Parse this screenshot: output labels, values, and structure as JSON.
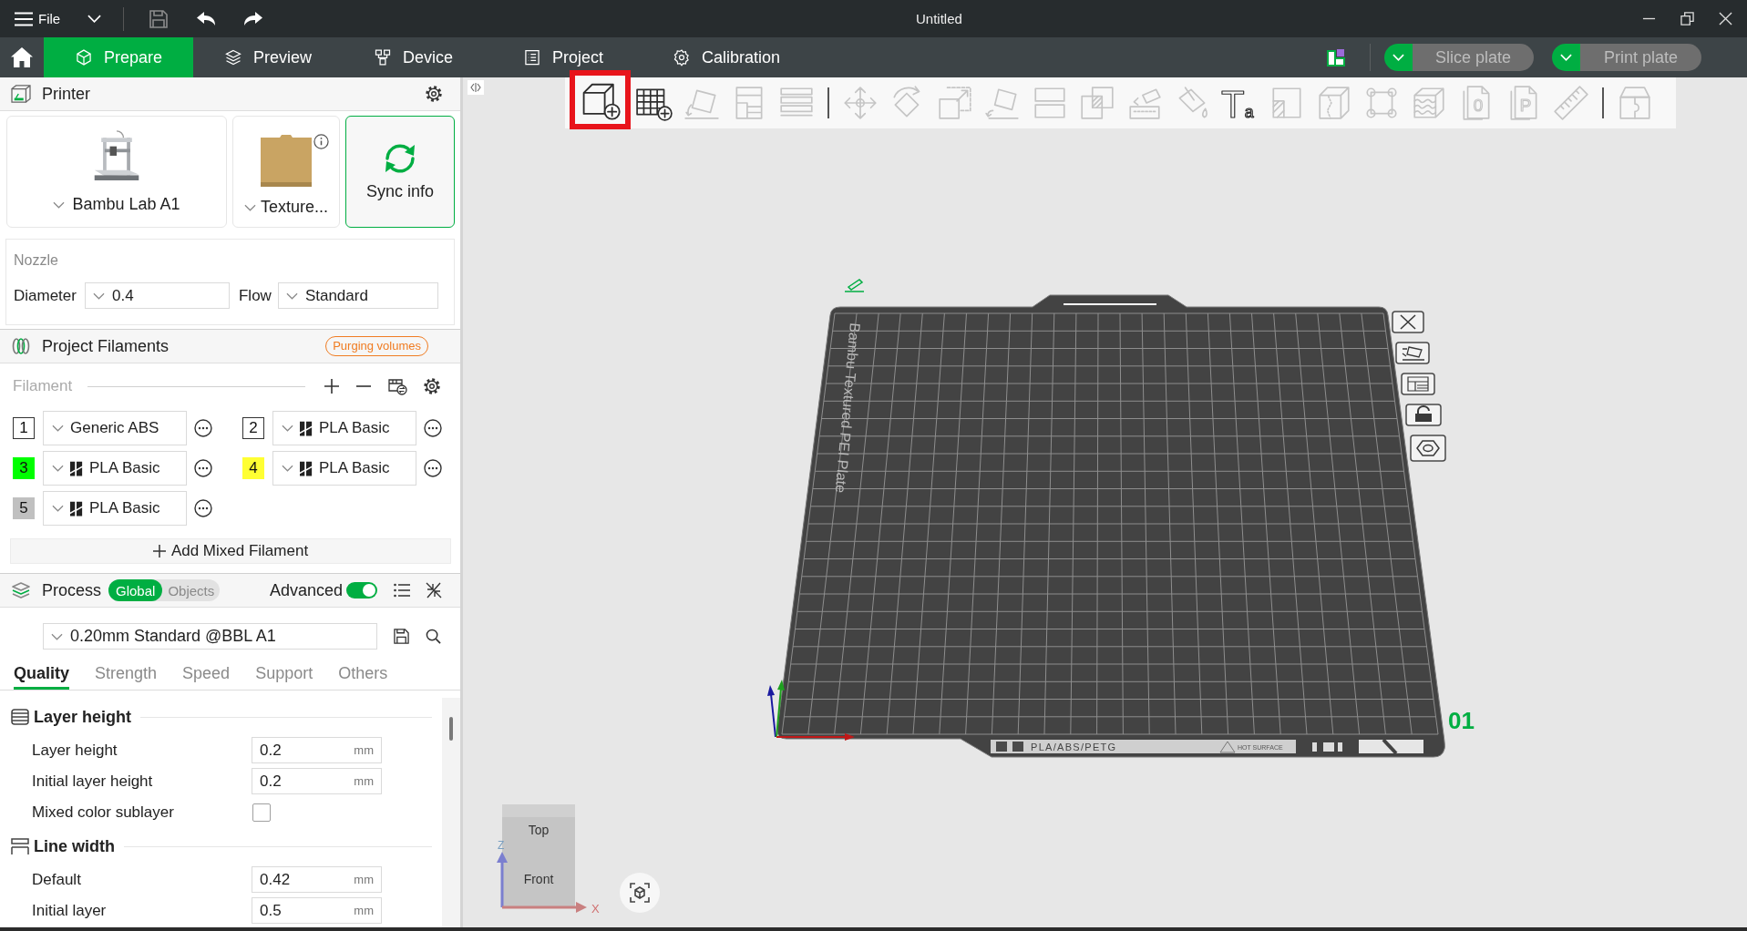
{
  "title_bar": {
    "menu": "File",
    "title": "Untitled"
  },
  "nav_tabs": [
    {
      "label": "Prepare",
      "kind": "prepare",
      "selected": true
    },
    {
      "label": "Preview",
      "kind": "preview",
      "selected": false
    },
    {
      "label": "Device",
      "kind": "device",
      "selected": false
    },
    {
      "label": "Project",
      "kind": "project",
      "selected": false
    },
    {
      "label": "Calibration",
      "kind": "calibration",
      "selected": false
    }
  ],
  "plate_actions": [
    {
      "label": "Slice plate",
      "disabled": true
    },
    {
      "label": "Print plate",
      "disabled": true
    }
  ],
  "printer": {
    "title": "Printer",
    "model": "Bambu Lab A1",
    "plate": "Texture...",
    "sync": "Sync info",
    "nozzle": {
      "title": "Nozzle",
      "diameter_label": "Diameter",
      "diameter": "0.4",
      "flow_label": "Flow",
      "flow": "Standard"
    }
  },
  "filaments": {
    "title": "Project Filaments",
    "purge": "Purging volumes",
    "label": "Filament",
    "items": [
      {
        "number": "1",
        "color": "#ffffff",
        "name": "Generic ABS",
        "brand_logo": false
      },
      {
        "number": "2",
        "color": "#ffffff",
        "name": "PLA Basic",
        "brand_logo": true
      },
      {
        "number": "3",
        "color": "#00ff00",
        "name": "PLA Basic",
        "brand_logo": true
      },
      {
        "number": "4",
        "color": "#ffff33",
        "name": "PLA Basic",
        "brand_logo": true
      },
      {
        "number": "5",
        "color": "#c0c0c0",
        "name": "PLA Basic",
        "brand_logo": true
      }
    ],
    "add_mixed": "Add Mixed Filament"
  },
  "process": {
    "title": "Process",
    "scopes": [
      {
        "label": "Global",
        "selected": true
      },
      {
        "label": "Objects",
        "selected": false
      }
    ],
    "advanced": {
      "label": "Advanced",
      "on": true
    },
    "preset": "0.20mm Standard @BBL A1",
    "tabs": [
      {
        "label": "Quality",
        "selected": true
      },
      {
        "label": "Strength",
        "selected": false
      },
      {
        "label": "Speed",
        "selected": false
      },
      {
        "label": "Support",
        "selected": false
      },
      {
        "label": "Others",
        "selected": false
      }
    ],
    "sections": [
      {
        "title": "Layer height",
        "kind": "layers",
        "rows": [
          {
            "kind": "number",
            "label": "Layer height",
            "value": "0.2",
            "unit": "mm"
          },
          {
            "kind": "number",
            "label": "Initial layer height",
            "value": "0.2",
            "unit": "mm"
          },
          {
            "kind": "checkbox",
            "label": "Mixed color sublayer",
            "checked": false
          }
        ]
      },
      {
        "title": "Line width",
        "kind": "width",
        "rows": [
          {
            "kind": "number",
            "label": "Default",
            "value": "0.42",
            "unit": "mm"
          },
          {
            "kind": "number",
            "label": "Initial layer",
            "value": "0.5",
            "unit": "mm"
          }
        ]
      }
    ]
  },
  "toolbar": {
    "groups": [
      [
        {
          "kind": "add",
          "disabled": false,
          "highlighted": true
        },
        {
          "kind": "addplate",
          "disabled": false,
          "highlighted": false
        },
        {
          "kind": "orient",
          "disabled": true,
          "highlighted": false
        },
        {
          "kind": "arrange",
          "disabled": true,
          "highlighted": false
        },
        {
          "kind": "platelist",
          "disabled": true,
          "highlighted": false
        }
      ],
      [
        {
          "kind": "move",
          "disabled": true,
          "highlighted": false
        },
        {
          "kind": "rotate",
          "disabled": true,
          "highlighted": false
        },
        {
          "kind": "scale",
          "disabled": true,
          "highlighted": false
        },
        {
          "kind": "layface",
          "disabled": true,
          "highlighted": false
        },
        {
          "kind": "split",
          "disabled": true,
          "highlighted": false
        },
        {
          "kind": "boolean",
          "disabled": true,
          "highlighted": false
        },
        {
          "kind": "supportpaint",
          "disabled": true,
          "highlighted": false
        },
        {
          "kind": "colorpaint",
          "disabled": true,
          "highlighted": false
        },
        {
          "kind": "text",
          "glyph": "Ta",
          "disabled": false,
          "highlighted": false
        },
        {
          "kind": "hatch",
          "disabled": true,
          "highlighted": false
        },
        {
          "kind": "seam",
          "disabled": true,
          "highlighted": false
        },
        {
          "kind": "measure",
          "disabled": true,
          "highlighted": false
        },
        {
          "kind": "fuzzy",
          "disabled": true,
          "highlighted": false
        },
        {
          "kind": "document",
          "glyph": "0",
          "disabled": true,
          "highlighted": false
        },
        {
          "kind": "document",
          "glyph": "P",
          "disabled": true,
          "highlighted": false
        },
        {
          "kind": "ruler",
          "disabled": true,
          "highlighted": false
        }
      ],
      [
        {
          "kind": "assembly",
          "disabled": true,
          "highlighted": false
        }
      ]
    ]
  },
  "plate": {
    "label": "Bambu Textured PEI Plate",
    "materials": "PLA/ABS/PETG",
    "warning": "HOT SURFACE",
    "number": "01"
  },
  "view_cube": {
    "top": "Top",
    "front": "Front",
    "x_axis": "X",
    "z_axis": "Z"
  }
}
